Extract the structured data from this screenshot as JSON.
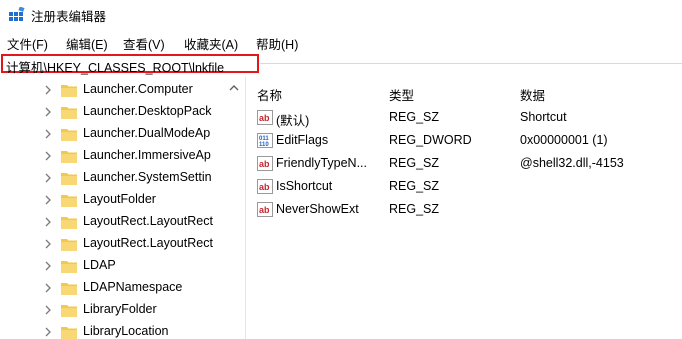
{
  "window": {
    "title": "注册表编辑器"
  },
  "menu": [
    {
      "label": "文件(F)"
    },
    {
      "label": "编辑(E)"
    },
    {
      "label": "查看(V)"
    },
    {
      "label": "收藏夹(A)"
    },
    {
      "label": "帮助(H)"
    }
  ],
  "address": {
    "path": "计算机\\HKEY_CLASSES_ROOT\\lnkfile"
  },
  "tree": {
    "items": [
      {
        "label": "Launcher.Computer"
      },
      {
        "label": "Launcher.DesktopPack"
      },
      {
        "label": "Launcher.DualModeAp"
      },
      {
        "label": "Launcher.ImmersiveAp"
      },
      {
        "label": "Launcher.SystemSettin"
      },
      {
        "label": "LayoutFolder"
      },
      {
        "label": "LayoutRect.LayoutRect"
      },
      {
        "label": "LayoutRect.LayoutRect"
      },
      {
        "label": "LDAP"
      },
      {
        "label": "LDAPNamespace"
      },
      {
        "label": "LibraryFolder"
      },
      {
        "label": "LibraryLocation"
      }
    ]
  },
  "list": {
    "columns": {
      "name": "名称",
      "type": "类型",
      "data": "数据"
    },
    "rows": [
      {
        "icon": "string-value-icon",
        "name": "(默认)",
        "type": "REG_SZ",
        "data": "Shortcut"
      },
      {
        "icon": "binary-value-icon",
        "name": "EditFlags",
        "type": "REG_DWORD",
        "data": "0x00000001 (1)"
      },
      {
        "icon": "string-value-icon",
        "name": "FriendlyTypeN...",
        "type": "REG_SZ",
        "data": "@shell32.dll,-4153"
      },
      {
        "icon": "string-value-icon",
        "name": "IsShortcut",
        "type": "REG_SZ",
        "data": ""
      },
      {
        "icon": "string-value-icon",
        "name": "NeverShowExt",
        "type": "REG_SZ",
        "data": ""
      }
    ]
  },
  "colors": {
    "address_border": "#e0181b",
    "folder": "#f3c94c",
    "chevron": "#7a7a7a",
    "string_icon": "#c4262e",
    "binary_icon": "#1f5fbf"
  }
}
